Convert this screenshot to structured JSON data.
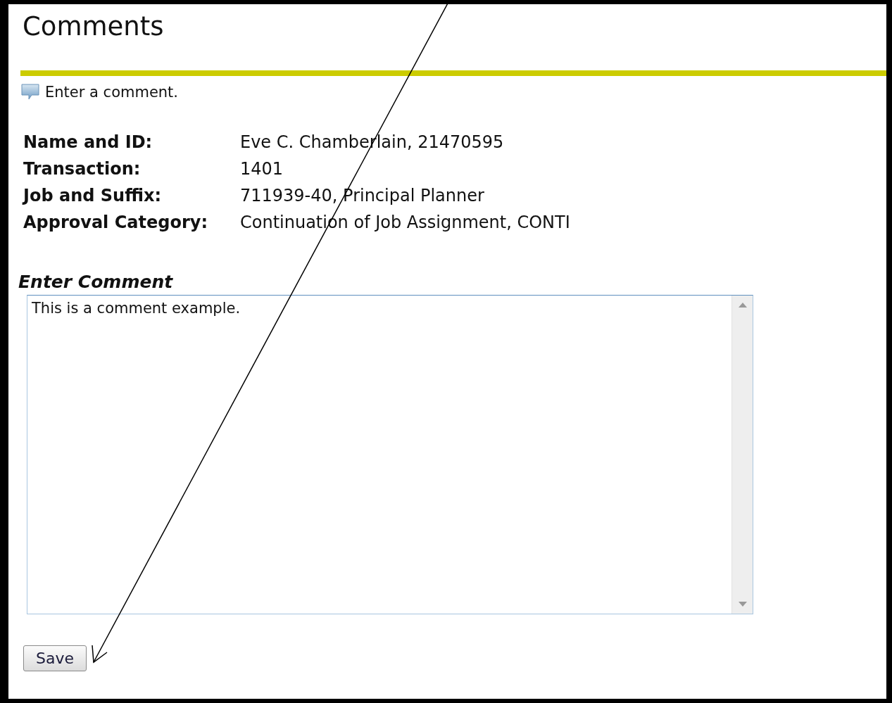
{
  "page_title": "Comments",
  "instruction": "Enter a comment.",
  "details": [
    {
      "label": "Name and ID:",
      "value": "Eve C. Chamberlain, 21470595"
    },
    {
      "label": "Transaction:",
      "value": "1401"
    },
    {
      "label": "Job and Suffix:",
      "value": "711939-40, Principal Planner"
    },
    {
      "label": "Approval Category:",
      "value": "Continuation of Job Assignment, CONTI"
    }
  ],
  "comment": {
    "label": "Enter Comment",
    "value": "This is a comment example."
  },
  "buttons": [
    "Save"
  ]
}
